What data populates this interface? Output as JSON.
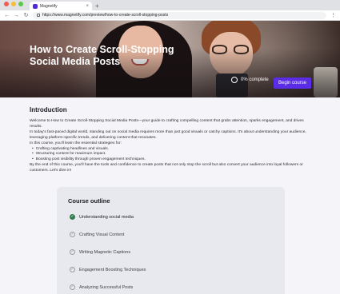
{
  "browser": {
    "tab_title": "Magnetify",
    "tab_close": "×",
    "new_tab": "+",
    "back": "←",
    "forward": "→",
    "reload": "↻",
    "url": "https://www.magnetify.com/preview/how-to-create-scroll-stopping-posts",
    "menu": "⋮"
  },
  "hero": {
    "title": "How to Create Scroll-Stopping Social Media Posts",
    "progress_text": "0% complete",
    "progress_percent": 0,
    "begin_label": "Begin course"
  },
  "intro": {
    "heading": "Introduction",
    "paragraphs": [
      "Welcome to How to Create Scroll-Stopping Social Media Posts—your guide to crafting compelling content that grabs attention, sparks engagement, and drives results.",
      "In today's fast-paced digital world, standing out on social media requires more than just good visuals or catchy captions. It's about understanding your audience, leveraging platform-specific trends, and delivering content that resonates.",
      "In this course, you'll learn the essential strategies for:"
    ],
    "bullets": [
      "Crafting captivating headlines and visuals.",
      "Structuring content for maximum impact.",
      "Boosting post visibility through proven engagement techniques."
    ],
    "closing": "By the end of this course, you'll have the tools and confidence to create posts that not only stop the scroll but also convert your audience into loyal followers or customers. Let's dive in!"
  },
  "outline": {
    "heading": "Course outline",
    "items": [
      {
        "label": "Understanding social media",
        "active": true
      },
      {
        "label": "Crafting Visual Content",
        "active": false
      },
      {
        "label": "Writing Magnetic Captions",
        "active": false
      },
      {
        "label": "Engagement Boosting Techniques",
        "active": false
      },
      {
        "label": "Analyzing Successful Posts",
        "active": false
      }
    ],
    "check_glyph": "✓"
  },
  "colors": {
    "accent": "#5b2ce6",
    "complete": "#2e7d4f"
  }
}
